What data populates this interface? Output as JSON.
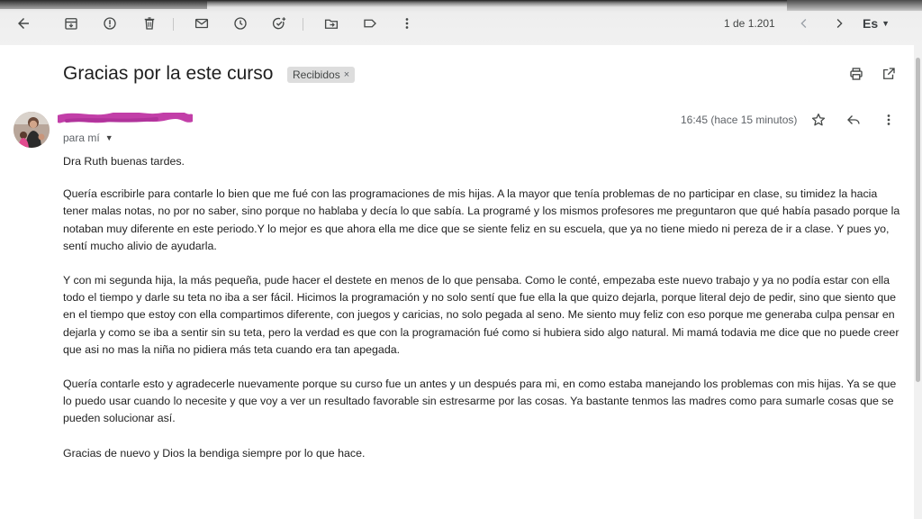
{
  "toolbar": {
    "page_counter": "1 de 1.201",
    "language": "Es",
    "icons": [
      "back-arrow-icon",
      "archive-icon",
      "report-spam-icon",
      "delete-icon",
      "mark-unread-icon",
      "snooze-icon",
      "add-task-icon",
      "move-to-icon",
      "label-icon",
      "more-vert-icon",
      "newer-chevron-icon",
      "older-chevron-icon"
    ]
  },
  "email": {
    "subject": "Gracias por la este curso",
    "label_chip": "Recibidos",
    "label_chip_close": "×",
    "to_line": "para mí",
    "time": "16:45 (hace 15 minutos)",
    "body": {
      "p1": "Dra Ruth buenas tardes.",
      "p2": "Quería escribirle para contarle lo bien que me fué con las programaciones de mis hijas. A la mayor que tenía problemas de no participar en clase, su timidez la hacia tener malas notas, no por no saber, sino porque no hablaba y decía lo que sabía. La programé y los mismos profesores me preguntaron que qué había pasado porque la notaban muy diferente en este periodo.Y lo mejor es que ahora ella me dice que se siente feliz en su escuela, que ya no tiene miedo ni pereza de ir a clase. Y pues yo, sentí mucho alivio de ayudarla.",
      "p3": "Y con mi segunda hija, la más pequeña, pude hacer el destete en menos de lo que pensaba. Como le conté, empezaba este nuevo trabajo y ya no podía estar con ella todo el tiempo y darle su teta no iba a ser fácil. Hicimos la programación y no solo sentí que fue ella la que quizo dejarla, porque literal dejo de pedir, sino que siento que en el tiempo que estoy con ella compartimos diferente, con juegos y caricias, no solo pegada al seno. Me siento muy feliz con eso porque me generaba culpa pensar en dejarla y como se iba a sentir sin su teta, pero la verdad es que con la programación fué como si hubiera sido algo natural. Mi mamá todavia me dice que no puede creer que asi no mas la niña no pidiera más teta cuando era tan apegada.",
      "p4": "Quería contarle esto y agradecerle nuevamente porque su curso fue un antes y un después para mi, en como estaba manejando los problemas con mis hijas. Ya se que lo puedo usar cuando lo necesite y que voy a ver un resultado favorable sin estresarme por las cosas. Ya bastante tenmos las madres como para sumarle cosas que se pueden solucionar así.",
      "p5": "Gracias de nuevo y Dios la bendiga siempre por lo que hace."
    }
  },
  "colors": {
    "redaction": "#c23fa8",
    "toolbar_bg": "#f1f1f1",
    "chip_bg": "#dddddd"
  }
}
